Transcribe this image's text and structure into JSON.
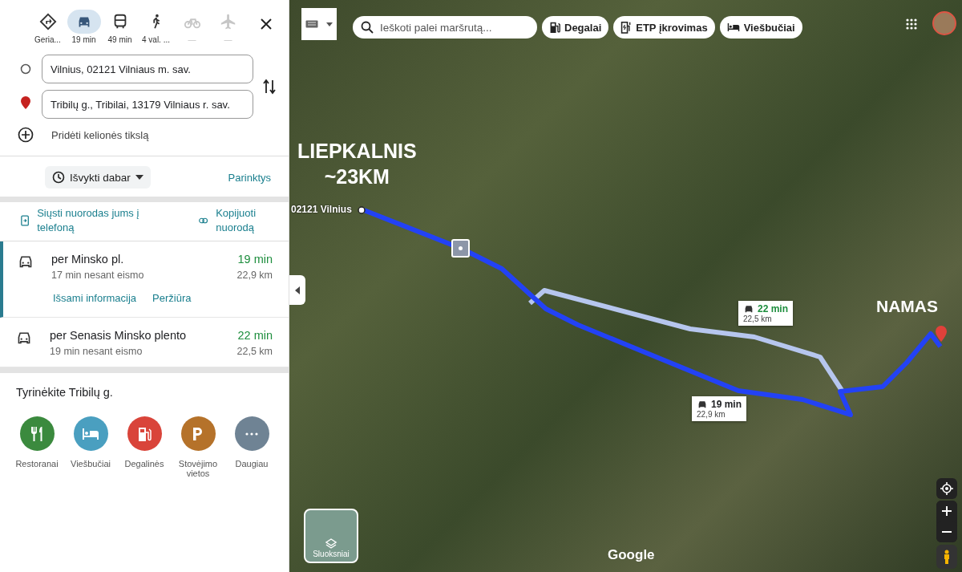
{
  "travel_modes": [
    {
      "kind": "best",
      "label": "Geria...",
      "selected": false,
      "disabled": false
    },
    {
      "kind": "car",
      "label": "19 min",
      "selected": true,
      "disabled": false
    },
    {
      "kind": "transit",
      "label": "49 min",
      "selected": false,
      "disabled": false
    },
    {
      "kind": "walk",
      "label": "4 val. ...",
      "selected": false,
      "disabled": false
    },
    {
      "kind": "bike",
      "label": "—",
      "selected": false,
      "disabled": true
    },
    {
      "kind": "flight",
      "label": "—",
      "selected": false,
      "disabled": true
    }
  ],
  "waypoints": [
    {
      "kind": "origin",
      "value": "Vilnius, 02121 Vilniaus m. sav."
    },
    {
      "kind": "destination",
      "value": "Tribilų g., Tribilai, 13179 Vilniaus r. sav."
    }
  ],
  "add_destination": "Pridėti kelionės tikslą",
  "depart_button": "Išvykti dabar",
  "options_link": "Parinktys",
  "send_link": "Siųsti nuorodas jums į telefoną",
  "copy_link": "Kopijuoti nuorodą",
  "routes": [
    {
      "selected": true,
      "name": "per Minsko pl.",
      "duration": "19 min",
      "note": "17 min nesant eismo",
      "distance": "22,9 km",
      "links": [
        "Išsami informacija",
        "Peržiūra"
      ]
    },
    {
      "selected": false,
      "name": "per Senasis Minsko plento",
      "duration": "22 min",
      "note": "19 min nesant eismo",
      "distance": "22,5 km"
    }
  ],
  "explore": {
    "title": "Tyrinėkite Tribilų g.",
    "items": [
      {
        "kind": "restaurant",
        "label": "Restoranai",
        "color": "#3b8a3e"
      },
      {
        "kind": "hotel",
        "label": "Viešbučiai",
        "color": "#4a9fc0"
      },
      {
        "kind": "fuel",
        "label": "Degalinės",
        "color": "#d9443a"
      },
      {
        "kind": "parking",
        "label": "Stovėjimo vietos",
        "color": "#b5722a"
      },
      {
        "kind": "more",
        "label": "Daugiau",
        "color": "#6f8394"
      }
    ]
  },
  "map": {
    "search_placeholder": "Ieškoti palei maršrutą...",
    "chips": [
      {
        "kind": "fuel",
        "label": "Degalai"
      },
      {
        "kind": "ev",
        "label": "ETP įkrovimas"
      },
      {
        "kind": "hotel",
        "label": "Viešbučiai"
      }
    ],
    "origin_label": "02121 Vilnius",
    "annotations": [
      {
        "kind": "start",
        "lines": [
          "LIEPKALNIS",
          "~23KM"
        ]
      },
      {
        "kind": "end",
        "lines": [
          "NAMAS"
        ]
      }
    ],
    "callouts": [
      {
        "kind": "alt",
        "duration": "22 min",
        "distance": "22,5 km"
      },
      {
        "kind": "main",
        "duration": "19 min",
        "distance": "22,9 km"
      }
    ],
    "layers_label": "Sluoksniai",
    "logo": "Google"
  }
}
